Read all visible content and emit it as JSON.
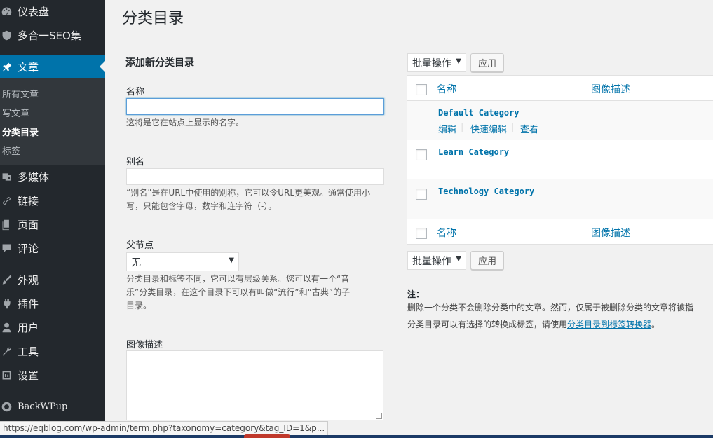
{
  "sidebar": {
    "dashboard": "仪表盘",
    "seo": "多合一SEO集",
    "posts": "文章",
    "submenu": [
      "所有文章",
      "写文章",
      "分类目录",
      "标签"
    ],
    "media": "多媒体",
    "links": "链接",
    "pages": "页面",
    "comments": "评论",
    "appearance": "外观",
    "plugins": "插件",
    "users": "用户",
    "tools": "工具",
    "settings": "设置",
    "backwpup": "BackWPup"
  },
  "page": {
    "title": "分类目录"
  },
  "form": {
    "heading": "添加新分类目录",
    "name_label": "名称",
    "name_value": "",
    "name_help": "这将是它在站点上显示的名字。",
    "slug_label": "别名",
    "slug_value": "",
    "slug_help_1": "“别名”是在URL中使用的别称，它可以令URL更美观。通常使用小",
    "slug_help_2": "写，只能包含字母，数字和连字符（-）。",
    "parent_label": "父节点",
    "parent_value": "无",
    "parent_help_1": "分类目录和标签不同，它可以有层级关系。您可以有一个“音",
    "parent_help_2": "乐”分类目录，在这个目录下可以有叫做“流行”和“古典”的子",
    "parent_help_3": "目录。",
    "image_label": "图像描述"
  },
  "list": {
    "bulk_label": "批量操作",
    "apply_label": "应用",
    "col_name": "名称",
    "col_image": "图像描述",
    "rows": [
      {
        "name": "Default Category",
        "actions": [
          "编辑",
          "快速编辑",
          "查看"
        ]
      },
      {
        "name": "Learn Category"
      },
      {
        "name": "Technology Category"
      }
    ],
    "note_heading": "注：",
    "note_line1": "删除一个分类不会删除分类中的文章。然而，仅属于被删除分类的文章将被指",
    "note_line2_prefix": "分类目录可以有选择的转换成标签，请使用",
    "note_link": "分类目录到标签转换器",
    "note_line2_suffix": "。"
  },
  "statusbar": {
    "url": "https://eqblog.com/wp-admin/term.php?taxonomy=category&tag_ID=1&p..."
  }
}
